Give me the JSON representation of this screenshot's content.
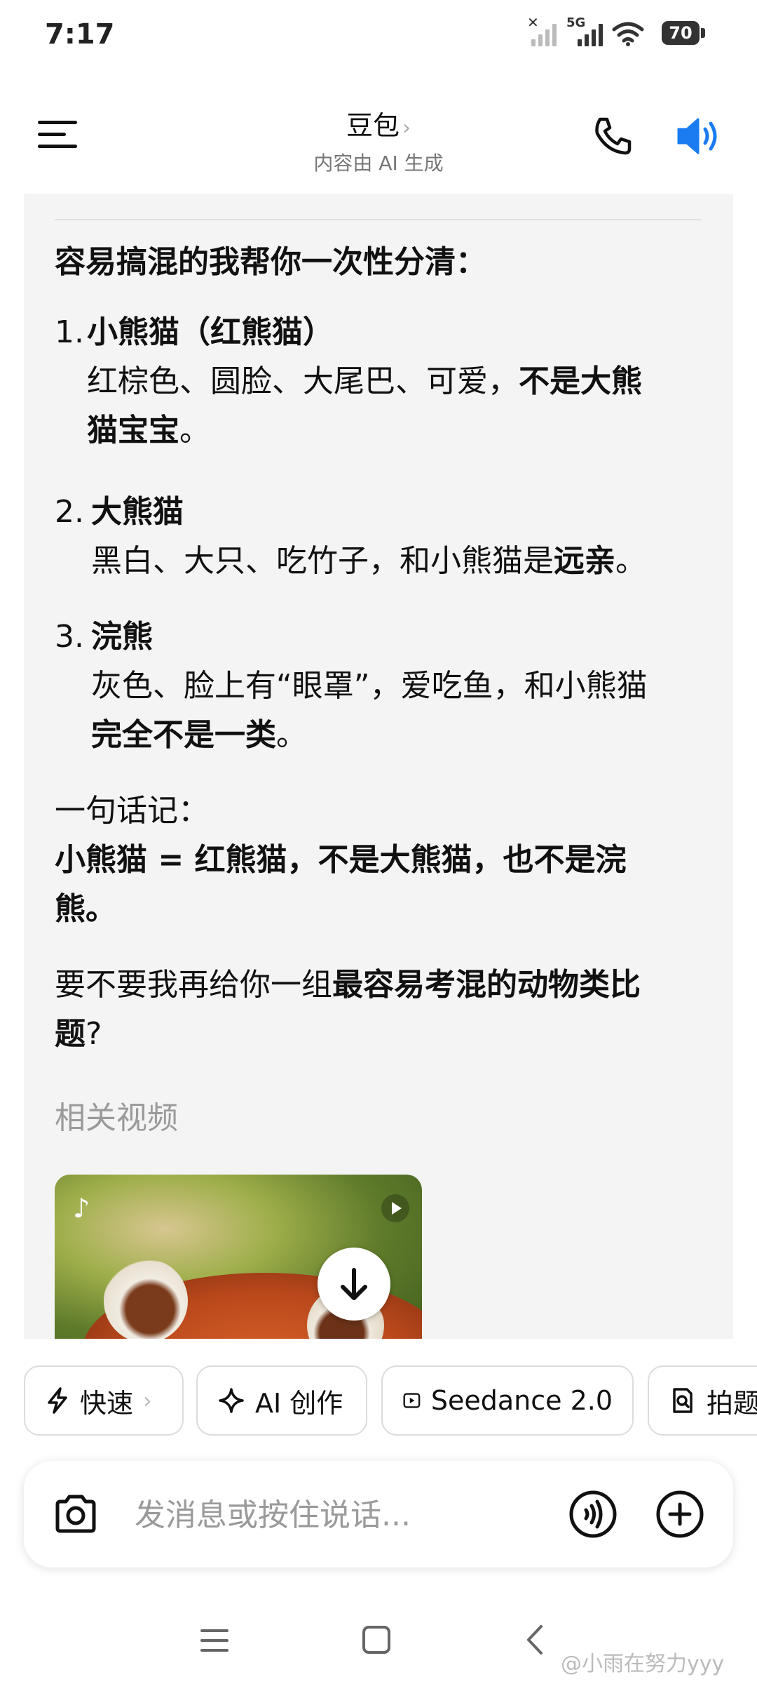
{
  "status_bar": {
    "time": "7:17",
    "network": "5G",
    "battery": "70"
  },
  "header": {
    "title": "豆包",
    "title_arrow": "›",
    "subtitle": "内容由 AI 生成"
  },
  "message": {
    "intro": "容易搞混的我帮你一次性分清：",
    "items": [
      {
        "num": "1.",
        "title": "小熊猫（红熊猫）",
        "line1_plain": "红棕色、圆脸、大尾巴、可爱，",
        "line1_bold": "不是大熊",
        "line2_bold": "猫宝宝",
        "line2_plain": "。"
      },
      {
        "num": "2.",
        "title": "大熊猫",
        "line1_plain": "黑白、大只、吃竹子，和小熊猫是",
        "line1_bold": "远亲",
        "line1_end": "。"
      },
      {
        "num": "3.",
        "title": "浣熊",
        "line1_plain": "灰色、脸上有“眼罩”，爱吃鱼，和小熊猫",
        "line2_bold": "完全不是一类",
        "line2_plain": "。"
      }
    ],
    "summary_label": "一句话记：",
    "summary_line1": "小熊猫 = 红熊猫，不是大熊猫，也不是浣",
    "summary_line2": "熊。",
    "question_plain": "要不要我再给你一组",
    "question_bold1": "最容易考混的动物类比",
    "question_bold2": "题",
    "question_end": "?",
    "related_label": "相关视频"
  },
  "chips": [
    {
      "label": "快速",
      "arrow": "›",
      "icon": "lightning-icon"
    },
    {
      "label": "AI 创作",
      "icon": "sparkle-icon"
    },
    {
      "label": "Seedance 2.0",
      "icon": "video-play-icon"
    },
    {
      "label": "拍题",
      "icon": "photo-search-icon"
    }
  ],
  "input": {
    "placeholder": "发消息或按住说话..."
  },
  "watermark": "@小雨在努力yyy",
  "colors": {
    "accent": "#1a7cf0",
    "card_bg": "#f4f4f4"
  }
}
